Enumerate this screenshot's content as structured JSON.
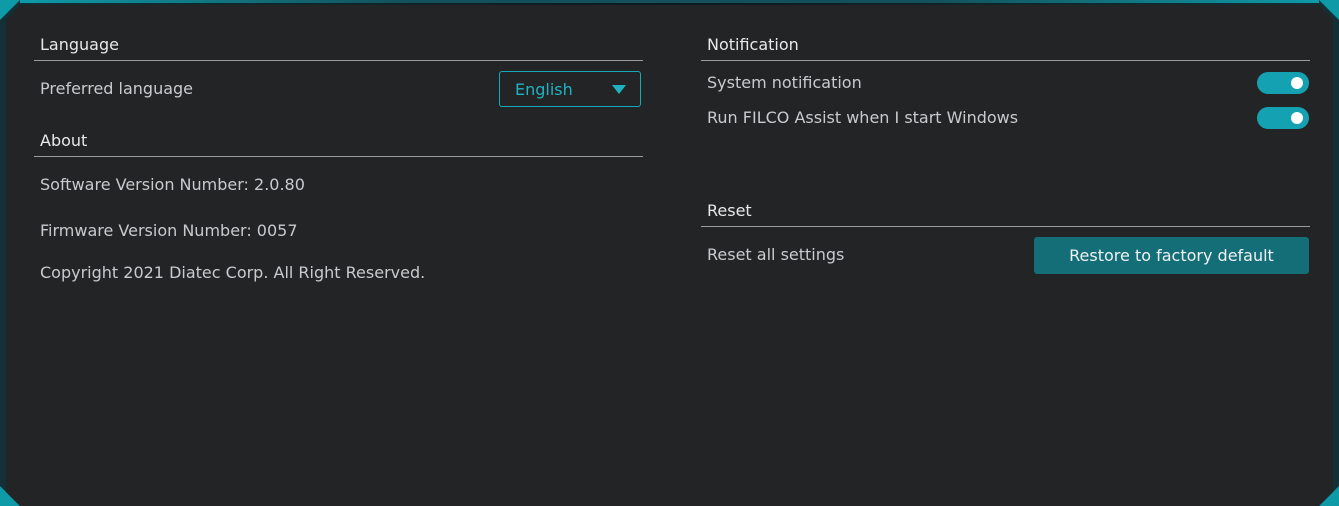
{
  "language": {
    "title": "Language",
    "preferred_label": "Preferred language",
    "selected": "English"
  },
  "about": {
    "title": "About",
    "software_version": "Software Version Number: 2.0.80",
    "firmware_version": "Firmware Version Number: 0057",
    "copyright": "Copyright 2021 Diatec Corp. All Right Reserved."
  },
  "notification": {
    "title": "Notification",
    "items": [
      {
        "label": "System notification",
        "enabled": true
      },
      {
        "label": "Run FILCO Assist when I start Windows",
        "enabled": true
      }
    ]
  },
  "reset": {
    "title": "Reset",
    "label": "Reset all settings",
    "button_label": "Restore to factory default"
  },
  "colors": {
    "accent": "#14a2b2",
    "panel_bg": "#232426",
    "button_bg": "#136e78"
  }
}
